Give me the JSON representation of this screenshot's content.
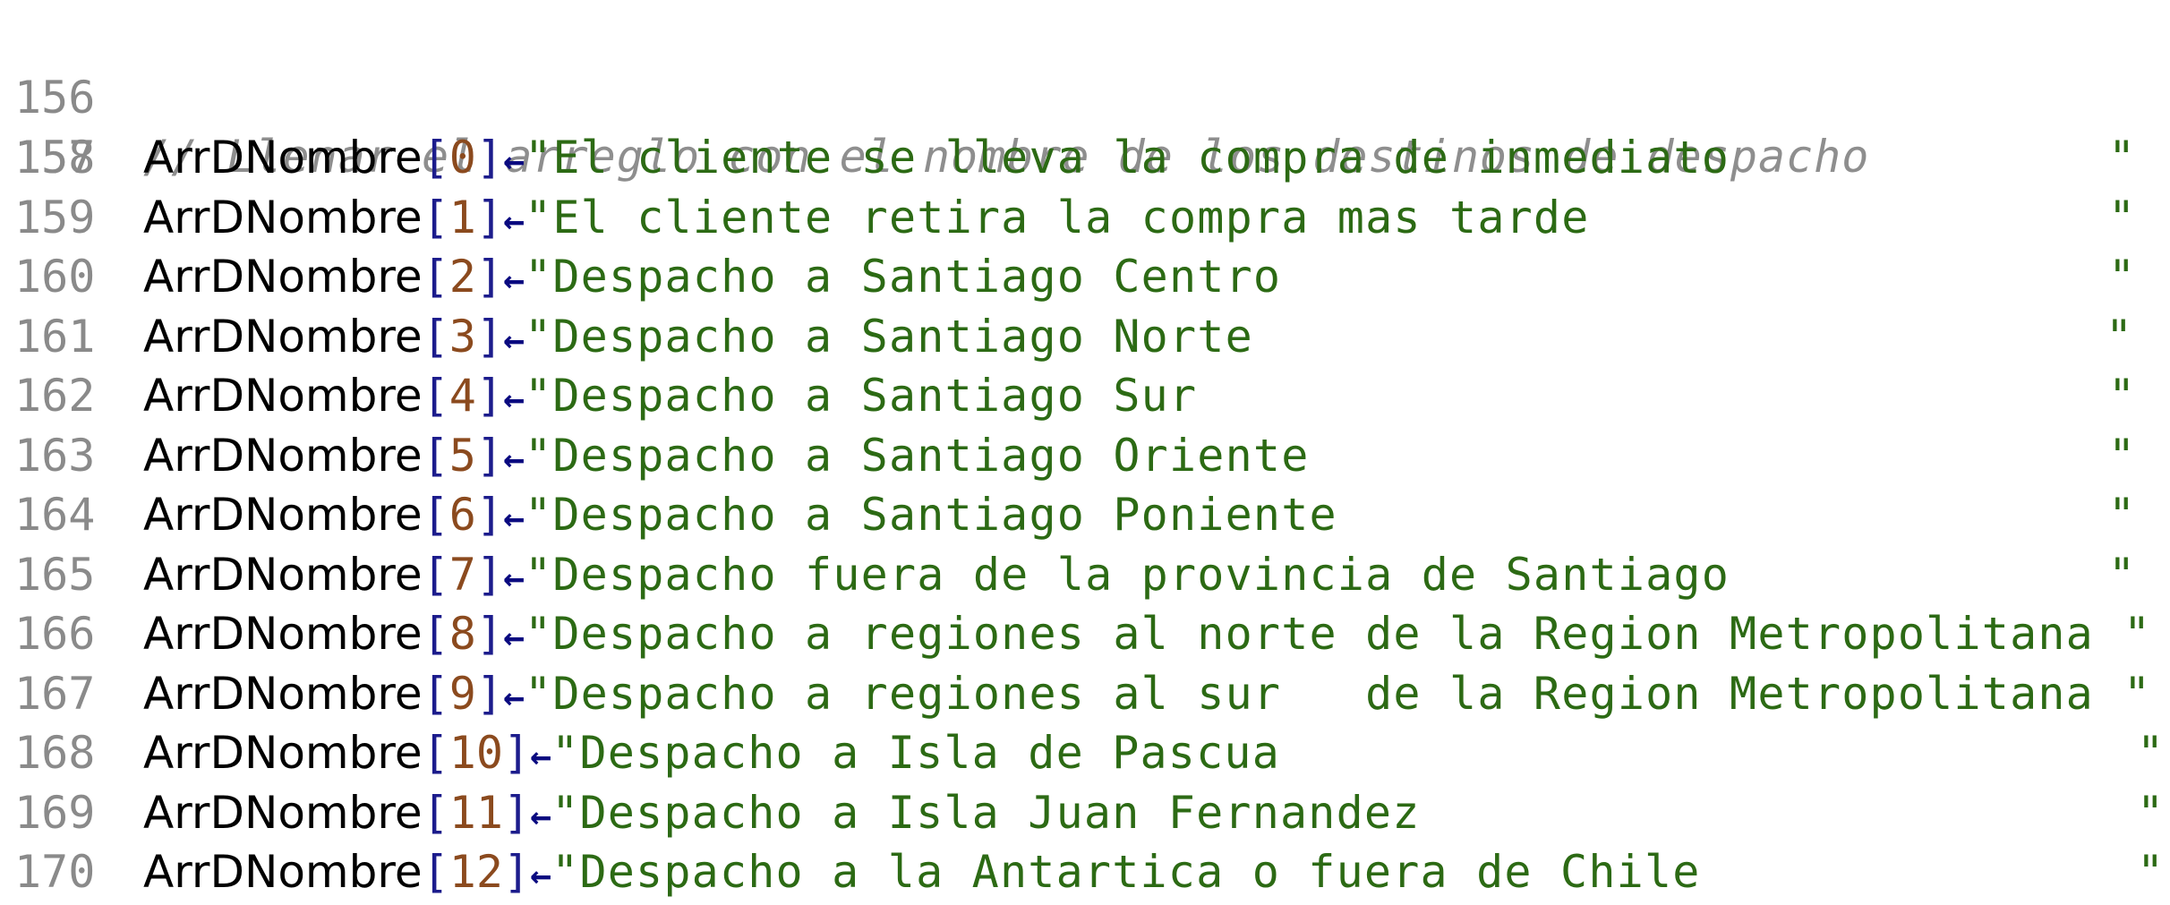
{
  "comment": {
    "line_number": "156",
    "text": "// Llenar el arreglo con el nombre de los destinos de despacho"
  },
  "blank_line": {
    "line_number": "157"
  },
  "array_name": "ArrDNombre",
  "assign_arrow": "←",
  "lines": [
    {
      "line_number": "158",
      "index": "0",
      "text": "\"El cliente se lleva la compra de inmediato",
      "end": "\""
    },
    {
      "line_number": "159",
      "index": "1",
      "text": "\"El cliente retira la compra mas tarde",
      "end": "\""
    },
    {
      "line_number": "160",
      "index": "2",
      "text": "\"Despacho a Santiago Centro",
      "end": "\""
    },
    {
      "line_number": "161",
      "index": "3",
      "text": "\"Despacho a Santiago Norte",
      "end": "\""
    },
    {
      "line_number": "162",
      "index": "4",
      "text": "\"Despacho a Santiago Sur",
      "end": "\""
    },
    {
      "line_number": "163",
      "index": "5",
      "text": "\"Despacho a Santiago Oriente",
      "end": "\""
    },
    {
      "line_number": "164",
      "index": "6",
      "text": "\"Despacho a Santiago Poniente",
      "end": "\""
    },
    {
      "line_number": "165",
      "index": "7",
      "text": "\"Despacho fuera de la provincia de Santiago",
      "end": "\""
    },
    {
      "line_number": "166",
      "index": "8",
      "text": "\"Despacho a regiones al norte de la Region Metropolitana",
      "end": "\""
    },
    {
      "line_number": "167",
      "index": "9",
      "text": "\"Despacho a regiones al sur   de la Region Metropolitana",
      "end": "\""
    },
    {
      "line_number": "168",
      "index": "10",
      "text": "\"Despacho a Isla de Pascua",
      "end": "\""
    },
    {
      "line_number": "169",
      "index": "11",
      "text": "\"Despacho a Isla Juan Fernandez",
      "end": "\""
    },
    {
      "line_number": "170",
      "index": "12",
      "text": "\"Despacho a la Antartica o fuera de Chile",
      "end": "\""
    }
  ],
  "colors": {
    "comment": "#8e8e8e",
    "line_number": "#8a8a8a",
    "identifier": "#000000",
    "bracket": "#1c1c8c",
    "index": "#8b4a1e",
    "arrow": "#0a0a80",
    "string": "#2c6a14"
  }
}
